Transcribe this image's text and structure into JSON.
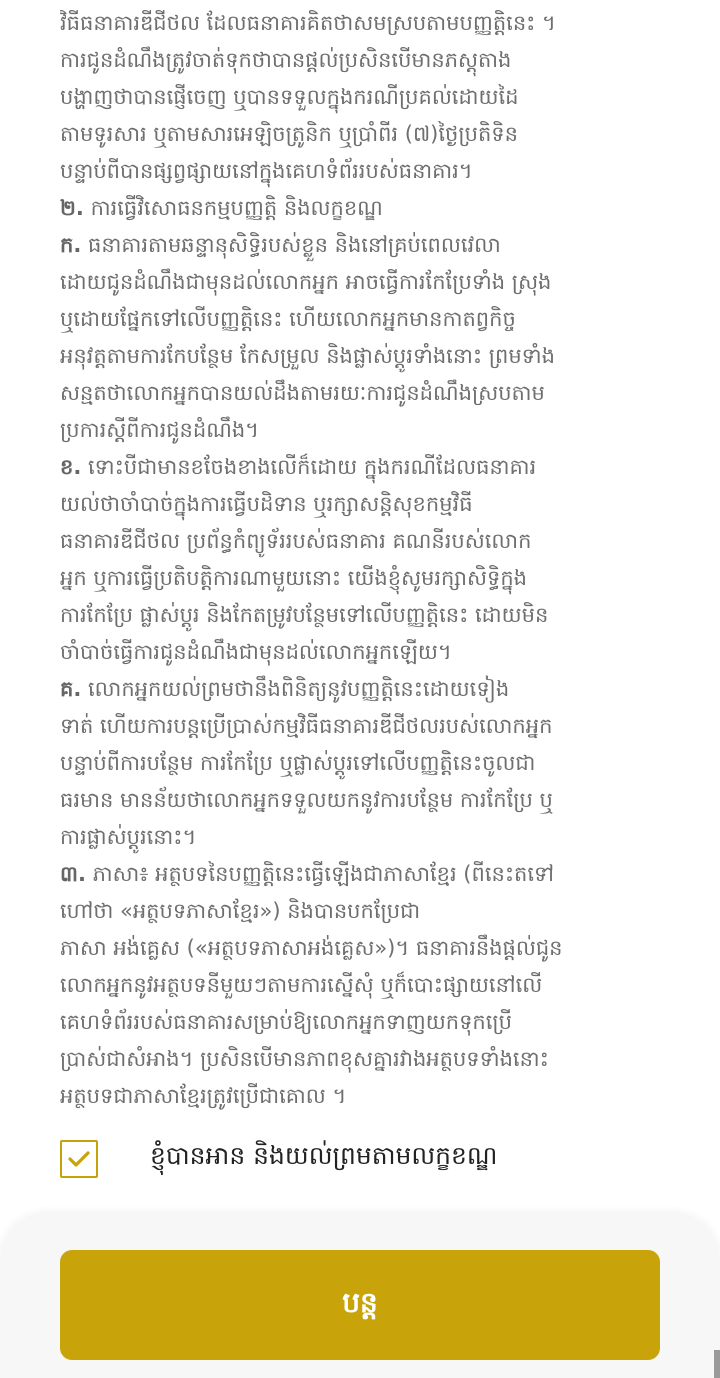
{
  "terms": {
    "lines": [
      "វិធីធនាគារឌីជីថល ដែលធនាគារគិតថាសមស្របតាមបញ្ញត្តិនេះ ។",
      "ការជូនដំណឹងត្រូវចាត់ទុកថាបានផ្តល់ប្រសិនបើមានភស្តុតាង",
      "បង្ហាញថាបានផ្ញើចេញ ឬបានទទួលក្នុងករណីប្រគល់ដោយដៃ",
      "តាមទូរសារ ឬតាមសារអេឡិចត្រូនិក ឬប្រាំពីរ (៧)ថ្ងៃប្រតិទិន",
      "បន្ទាប់ពីបានផ្សព្វផ្សាយនៅក្នុងគេហទំព័ររបស់ធនាគារ។"
    ],
    "s2_num": "២.",
    "s2_title": "ការធ្វើវិសោធនកម្មបញ្ញត្តិ និងលក្ខខណ្ឌ",
    "s2a_num": "ក.",
    "s2a_first": "ធនាគារតាមឆន្ទានុសិទ្ធិរបស់ខ្លួន និងនៅគ្រប់ពេលវេលា",
    "s2a_lines": [
      "ដោយជូនដំណឹងជាមុនដល់លោកអ្នក អាចធ្វើការកែប្រែទាំង ស្រុង",
      "ឬដោយផ្នែកទៅលើបញ្ញត្តិនេះ ហើយលោកអ្នកមានកាតព្វកិច្ច",
      "អនុវត្តតាមការកែបន្ថែម កែសម្រួល និងផ្លាស់ប្តូរទាំងនោះ ព្រមទាំង",
      "សន្មតថាលោកអ្នកបានយល់ដឹងតាមរយៈការជូនដំណឹងស្របតាម",
      "ប្រការស្តីពីការជូនដំណឹង។"
    ],
    "s2b_num": "ខ.",
    "s2b_first": "ទោះបីជាមានខចែងខាងលើក៏ដោយ  ក្នុងករណីដែលធនាគារ",
    "s2b_lines": [
      "យល់ថាចាំបាច់ក្នុងការធ្វើបដិទាន ឬរក្សាសន្តិសុខកម្មវិធី",
      "ធនាគារឌីជីថល ប្រព័ន្ធកំព្យូទ័ររបស់ធនាគារ គណនីរបស់លោក",
      "អ្នក ឬការធ្វើប្រតិបត្តិការណាមួយនោះ យើងខ្ញុំសូមរក្សាសិទ្ធិក្នុង",
      "ការកែប្រែ ផ្លាស់ប្តូរ និងកែតម្រូវបន្ថែមទៅលើបញ្ញត្តិនេះ ដោយមិន",
      "ចាំបាច់ធ្វើការជូនដំណឹងជាមុនដល់លោកអ្នកឡើយ។"
    ],
    "s2c_num": "គ.",
    "s2c_first": "លោកអ្នកយល់ព្រមថានឹងពិនិត្យនូវបញ្ញត្តិនេះដោយទៀង",
    "s2c_lines": [
      "ទាត់ ហើយការបន្តប្រើប្រាស់កម្មវិធីធនាគារឌីជីថលរបស់លោកអ្នក",
      "បន្ទាប់ពីការបន្ថែម ការកែប្រែ ឬផ្លាស់ប្តូរទៅលើបញ្ញត្តិនេះចូលជា",
      "ធរមាន មានន័យថាលោកអ្នកទទួលយកនូវការបន្ថែម ការកែប្រែ ឬ",
      "ការផ្លាស់ប្តូរនោះ។"
    ],
    "s3_num": "៣.",
    "s3_first": "ភាសា៖ អត្ថបទនៃបញ្ញត្តិនេះធ្វើឡើងជាភាសាខ្មែរ (ពីនេះតទៅ",
    "s3_lines": [
      "ហៅថា «អត្ថបទភាសាខ្មែរ») និងបានបកប្រែជា",
      "ភាសា អង់គ្លេស («អត្ថបទភាសាអង់គ្លេស»)។ ធនាគារនឹងផ្តល់ជូន",
      "លោកអ្នកនូវអត្ថបទនីមួយៗតាមការស្នើសុំ ឬក៏បោះផ្សាយនៅលើ",
      "គេហទំព័ររបស់ធនាគារសម្រាប់ឱ្យលោកអ្នកទាញយកទុកប្រើ",
      "ប្រាស់ជាសំអាង។ ប្រសិនបើមានភាពខុសគ្នារវាងអត្ថបទទាំងនោះ",
      "អត្ថបទជាភាសាខ្មែរត្រូវប្រើជាគោល ។"
    ]
  },
  "agreement": {
    "label": "ខ្ញុំបានអាន និងយល់ព្រមតាមលក្ខខណ្ឌ",
    "checked": true,
    "check_icon": "checkmark-icon"
  },
  "footer": {
    "continue_label": "បន្ត"
  },
  "colors": {
    "accent": "#c8a309",
    "text_muted": "#6e6e6e",
    "text_dark": "#222222"
  }
}
